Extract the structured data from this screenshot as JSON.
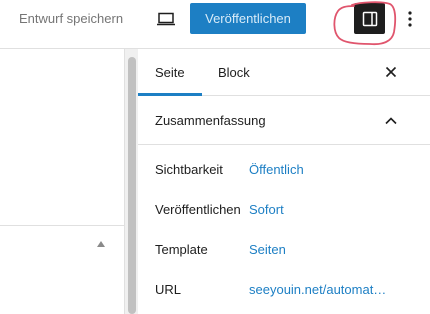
{
  "toolbar": {
    "save_draft_label": "Entwurf speichern",
    "publish_label": "Veröffentlichen"
  },
  "sidebar": {
    "tabs": [
      {
        "label": "Seite",
        "active": true
      },
      {
        "label": "Block",
        "active": false
      }
    ],
    "panel": {
      "title": "Zusammenfassung",
      "rows": [
        {
          "label": "Sichtbarkeit",
          "value": "Öffentlich"
        },
        {
          "label": "Veröffentlichen",
          "value": "Sofort"
        },
        {
          "label": "Template",
          "value": "Seiten"
        },
        {
          "label": "URL",
          "value": "seeyouin.net/automat…"
        }
      ]
    }
  },
  "colors": {
    "accent": "#1d7fc4",
    "dark": "#1e1e1e",
    "annotation": "#e0556d"
  },
  "icons": {
    "preview": "laptop-icon",
    "settings": "sidebar-panel-icon",
    "more": "vertical-ellipsis-icon",
    "close": "close-icon",
    "collapse": "chevron-up-icon",
    "editor_toggle": "triangle-up-icon"
  }
}
